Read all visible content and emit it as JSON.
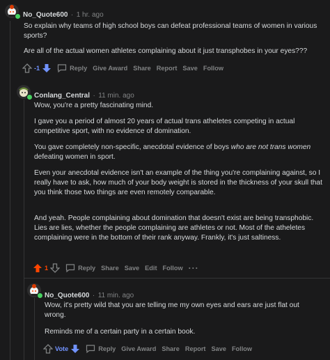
{
  "comments": [
    {
      "author": "No_Quote600",
      "time": "1 hr. ago",
      "paragraphs": [
        "So explain why teams of high school boys can defeat professional teams of women in various sports?",
        "Are all of the actual women athletes complaining about it just transphobes in your eyes???"
      ],
      "score": "-1",
      "actions": [
        "Reply",
        "Give Award",
        "Share",
        "Report",
        "Save",
        "Follow"
      ]
    },
    {
      "author": "Conlang_Central",
      "time": "11 min. ago",
      "p1": "Wow, you're a pretty fascinating mind.",
      "p2": "I gave you a period of almost 20 years of actual trans atheletes competing in actual competitive sport, with no evidence of domination.",
      "p3_a": "You gave completely non-specific, anecdotal evidence of boys ",
      "p3_em": "who are not trans women",
      "p3_b": " defeating women in sport.",
      "p4": "Even your anecdotal evidence isn't an example of the thing you're complaining against, so I really have to ask, how much of your body weight is stored in the thickness of your skull that you think those two things are even remotely comparable.",
      "p5": "And yeah. People complaining about domination that doesn't exist are being transphobic. Lies are lies, whether the people complaining are athletes or not. Most of the atheletes complaining were in the bottom of their rank anyway. Frankly, it's just saltiness.",
      "score": "1",
      "actions": [
        "Reply",
        "Share",
        "Save",
        "Edit",
        "Follow"
      ],
      "more": "···"
    },
    {
      "author": "No_Quote600",
      "time": "11 min. ago",
      "paragraphs": [
        "Wow, it's pretty wild that you are telling me my own eyes and ears are just flat out wrong.",
        "Reminds me of a certain party in a certain book."
      ],
      "score": "Vote",
      "actions": [
        "Reply",
        "Give Award",
        "Share",
        "Report",
        "Save",
        "Follow"
      ]
    }
  ],
  "separator": "·",
  "colors": {
    "upvote_active": "#ff4500",
    "downvote_active": "#7193ff",
    "online": "#46d160",
    "bg": "#1a1a1b"
  }
}
